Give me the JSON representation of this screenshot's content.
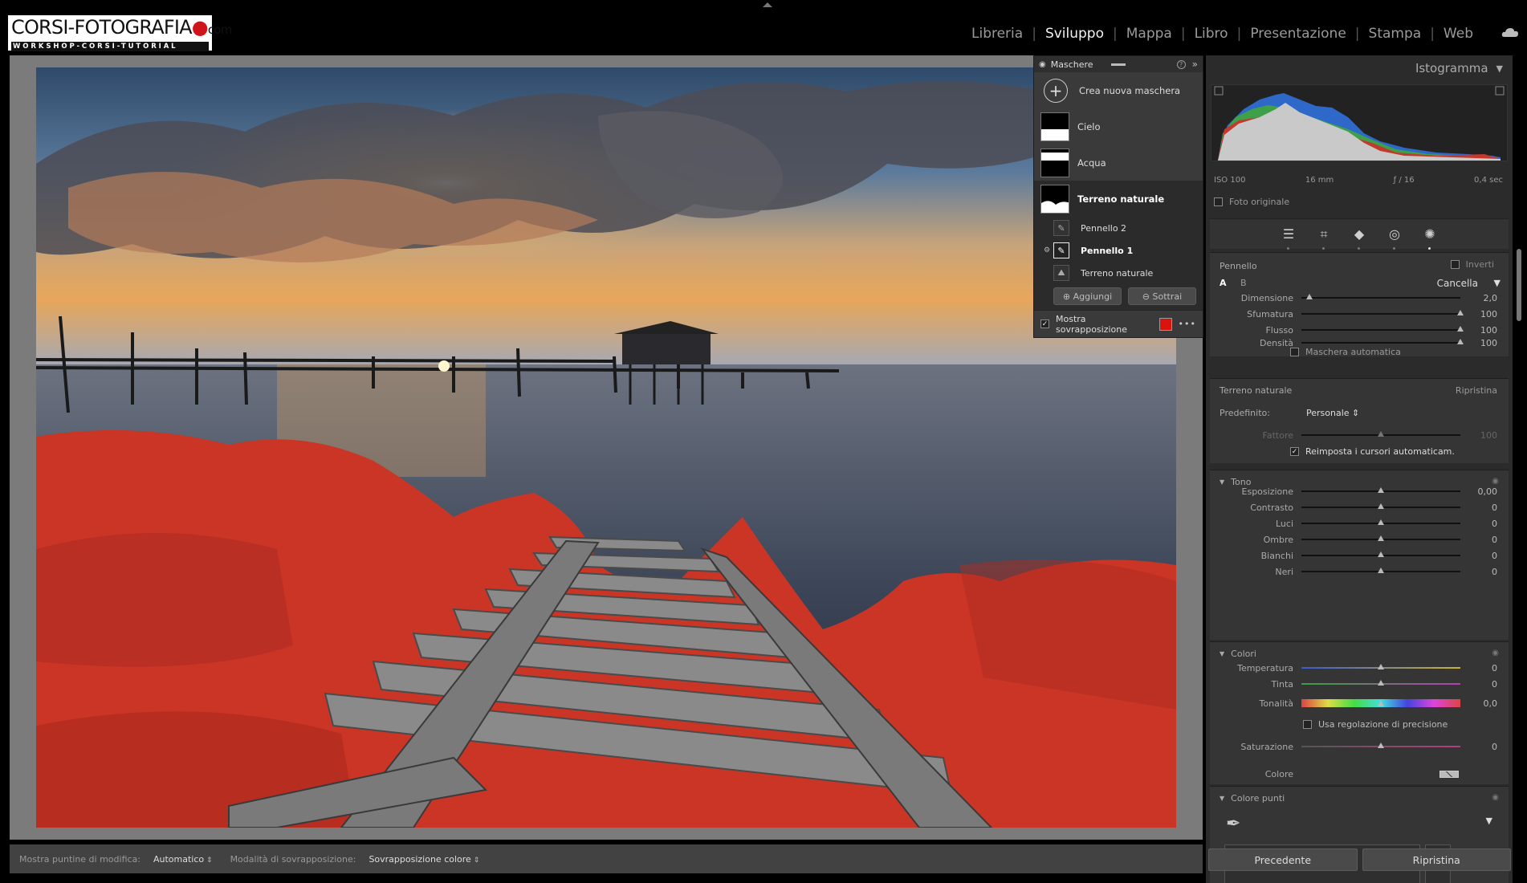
{
  "logo": {
    "main": "CORSI-FOTOGRAFIA",
    "dot": "●",
    "suffix": "com",
    "tagline": "WORKSHOP-CORSI-TUTORIAL"
  },
  "modules": [
    {
      "label": "Libreria",
      "active": false
    },
    {
      "label": "Sviluppo",
      "active": true
    },
    {
      "label": "Mappa",
      "active": false
    },
    {
      "label": "Libro",
      "active": false
    },
    {
      "label": "Presentazione",
      "active": false
    },
    {
      "label": "Stampa",
      "active": false
    },
    {
      "label": "Web",
      "active": false
    }
  ],
  "toolbar": {
    "pins_label": "Mostra puntine di modifica:",
    "pins_value": "Automatico",
    "overlay_label": "Modalità di sovrapposizione:",
    "overlay_value": "Sovrapposizione colore"
  },
  "mask_panel": {
    "title": "Maschere",
    "create": "Crea nuova maschera",
    "masks": [
      "Cielo",
      "Acqua",
      "Terreno naturale"
    ],
    "components": [
      "Pennello 2",
      "Pennello 1",
      "Terreno naturale"
    ],
    "add": "Aggiungi",
    "subtract": "Sottrai",
    "show_overlay": "Mostra sovrapposizione",
    "overlay_color": "#d9140f"
  },
  "histogram": {
    "title": "Istogramma",
    "iso": "ISO 100",
    "focal": "16 mm",
    "aperture": "ƒ / 16",
    "shutter": "0,4 sec",
    "original": "Foto originale"
  },
  "brush": {
    "title": "Pennello",
    "invert": "Inverti",
    "a": "A",
    "b": "B",
    "mode": "Cancella",
    "size_label": "Dimensione",
    "size": "2,0",
    "size_pct": 0.05,
    "feather_label": "Sfumatura",
    "feather": "100",
    "feather_pct": 1.0,
    "flow_label": "Flusso",
    "flow": "100",
    "flow_pct": 1.0,
    "density_label": "Densità",
    "density": "100",
    "density_pct": 1.0,
    "automask": "Maschera automatica"
  },
  "adjust": {
    "title": "Terreno naturale",
    "reset": "Ripristina",
    "preset_label": "Predefinito:",
    "preset_value": "Personale",
    "amount_label": "Fattore",
    "amount": "100",
    "auto_reset": "Reimposta i cursori automaticam."
  },
  "tone": {
    "title": "Tono",
    "rows": [
      {
        "label": "Esposizione",
        "value": "0,00"
      },
      {
        "label": "Contrasto",
        "value": "0"
      },
      {
        "label": "Luci",
        "value": "0"
      },
      {
        "label": "Ombre",
        "value": "0"
      },
      {
        "label": "Bianchi",
        "value": "0"
      },
      {
        "label": "Neri",
        "value": "0"
      }
    ]
  },
  "color": {
    "title": "Colori",
    "temp_label": "Temperatura",
    "temp": "0",
    "tint_label": "Tinta",
    "tint": "0",
    "hue_label": "Tonalità",
    "hue": "0,0",
    "fine": "Usa regolazione di precisione",
    "sat_label": "Saturazione",
    "sat": "0",
    "color_label": "Colore"
  },
  "point_color": {
    "title": "Colore punti"
  },
  "buttons": {
    "prev": "Precedente",
    "reset": "Ripristina"
  }
}
